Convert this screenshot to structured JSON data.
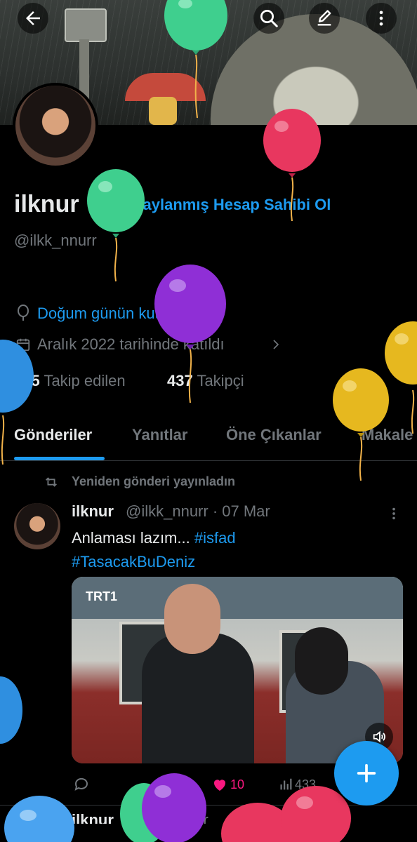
{
  "profile": {
    "name": "ilknur",
    "verify_cta": "Onaylanmış Hesap Sahibi Ol",
    "handle": "@ilkk_nnurr",
    "birthday": "Doğum günün kutlu olsun!",
    "joined": "Aralık 2022 tarihinde katıldı",
    "following_count": "425",
    "following_label": "Takip edilen",
    "followers_count": "437",
    "followers_label": "Takipçi"
  },
  "tabs": [
    {
      "label": "Gönderiler"
    },
    {
      "label": "Yanıtlar"
    },
    {
      "label": "Öne Çıkanlar"
    },
    {
      "label": "Makale"
    }
  ],
  "post": {
    "repost_label": "Yeniden gönderi yayınladın",
    "author": "ilknur",
    "meta": "@ilkk_nnurr · 07 Mar",
    "text": "Anlaması lazım...",
    "hashtag1": "#isfad",
    "hashtag2": "#TasacakBuDeniz",
    "media_badge": "TRT1",
    "likes": "10",
    "views": "433"
  },
  "next_post": {
    "author": "ilknur",
    "meta": "@ilkk_nnurr"
  },
  "colors": {
    "accent": "#1d9bf0",
    "like": "#f91880",
    "muted": "#71767b",
    "text": "#e7e9ea"
  },
  "icons": [
    "back-arrow-icon",
    "search-icon",
    "edit-icon",
    "more-vertical-icon",
    "verified-badge-icon",
    "balloon-icon",
    "calendar-icon",
    "chevron-right-icon",
    "repost-icon",
    "reply-icon",
    "heart-icon",
    "views-icon",
    "volume-icon",
    "plus-icon"
  ]
}
